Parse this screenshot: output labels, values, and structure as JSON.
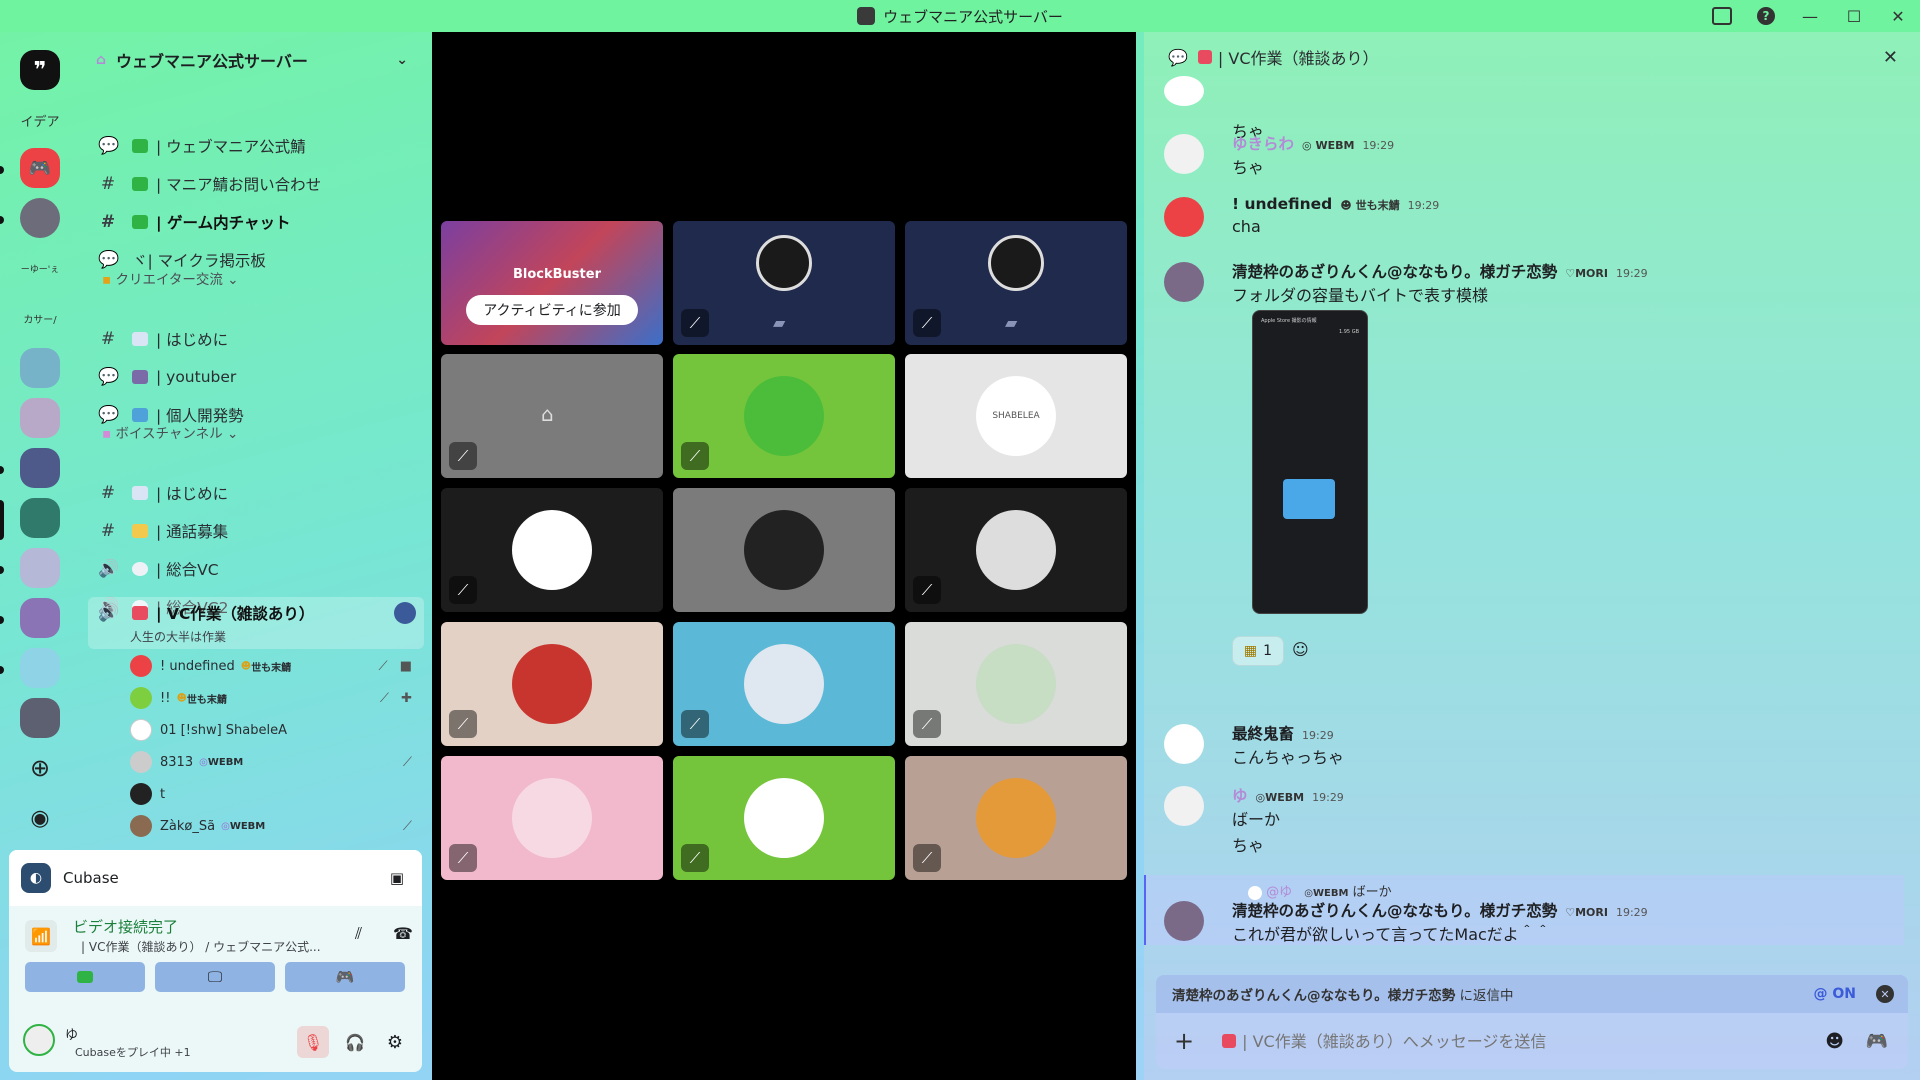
{
  "window": {
    "title": "ウェブマニア公式サーバー"
  },
  "rail": {
    "items": [
      {
        "label": "",
        "color": "#111111"
      },
      {
        "label": "イデア",
        "color": "transparent"
      },
      {
        "label": "",
        "color": "#ed4245"
      },
      {
        "label": "",
        "color": "#6c6c7a"
      },
      {
        "label": "ーゆー'ぇ",
        "color": "transparent"
      },
      {
        "label": "カサー/",
        "color": "transparent"
      },
      {
        "label": "",
        "color": "#76b3c9"
      },
      {
        "label": "",
        "color": "#b9a9c9"
      },
      {
        "label": "",
        "color": "#4d5a8a"
      },
      {
        "label": "",
        "color": "#2f7a6a"
      },
      {
        "label": "",
        "color": "#b6b8d8"
      },
      {
        "label": "",
        "color": "#8a74b5"
      },
      {
        "label": "",
        "color": "#8fd3e6"
      },
      {
        "label": "",
        "color": "#5c6070"
      }
    ]
  },
  "server": {
    "name": "ウェブマニア公式サーバー"
  },
  "channels": {
    "top": [
      {
        "label": "| ウェブマニア公式鯖",
        "icon": "forum",
        "bold": false
      },
      {
        "label": "| マニア鯖お問い合わせ",
        "icon": "hash",
        "bold": false
      },
      {
        "label": "| ゲーム内チャット",
        "icon": "hash",
        "bold": true
      },
      {
        "label": "ヾ| マイクラ掲示板",
        "icon": "forum",
        "bold": false
      }
    ],
    "creator_category": "クリエイター交流",
    "creator": [
      {
        "label": "| はじめに",
        "icon": "hash"
      },
      {
        "label": "| youtuber",
        "icon": "forum"
      },
      {
        "label": "| 個人開発勢",
        "icon": "forum"
      }
    ],
    "voice_category": "ボイスチャンネル",
    "voice": [
      {
        "label": "| はじめに",
        "icon": "hash"
      },
      {
        "label": "| 通話募集",
        "icon": "hash"
      },
      {
        "label": "| 総合VC",
        "icon": "speaker"
      },
      {
        "label": "| 総合VC2",
        "icon": "speaker"
      }
    ],
    "active_vc": {
      "label": "| VC作業（雑談あり）",
      "status": "人生の大半は作業"
    },
    "members": [
      {
        "name": "! undefined",
        "tag": "世も末鯖",
        "right": "⟋ ■",
        "color": "#ed4245"
      },
      {
        "name": "!!",
        "tag": "世も末鯖",
        "right": "⟋ ✚",
        "color": "#7ecf40"
      },
      {
        "name": "01 [!shw] ShabeleA",
        "tag": "",
        "right": "",
        "color": "#ffffff"
      },
      {
        "name": "8313",
        "tag": "WEBM",
        "right": "⟋",
        "color": "#cccccc"
      },
      {
        "name": "t",
        "tag": "",
        "right": "",
        "color": "#222222"
      },
      {
        "name": "Zàkø_Sã",
        "tag": "WEBM",
        "right": "⟋",
        "color": "#8a6a50"
      }
    ]
  },
  "activity": {
    "app": "Cubase"
  },
  "voice_status": {
    "title": "ビデオ接続完了",
    "sub": "| VC作業（雑談あり） / ウェブマニア公式..."
  },
  "user": {
    "name": "ゆ",
    "status": "Cubaseをプレイ中 +1"
  },
  "stage": {
    "activity_title": "BlockBuster",
    "activity_button": "アクティビティに参加",
    "tile_labels": [
      "SHABELEA"
    ]
  },
  "chat": {
    "channel": "| VC作業（雑談あり）",
    "messages": [
      {
        "author": "",
        "time": "",
        "body": "ちゃ",
        "tag": ""
      },
      {
        "author": "ゆきらわ",
        "time": "19:29",
        "body": "ちゃ",
        "tag": "WEBM"
      },
      {
        "author": "! undefined",
        "time": "19:29",
        "body": "cha",
        "tag": "世も末鯖"
      },
      {
        "author": "清楚枠のあざりんくん@ななもり。様ガチ恋勢",
        "time": "19:29",
        "body": "フォルダの容量もバイトで表す模様",
        "tag": "MORI"
      },
      {
        "author": "最終鬼畜",
        "time": "19:29",
        "body": "こんちゃっちゃ",
        "tag": ""
      },
      {
        "author": "ゆ",
        "time": "19:29",
        "body": "ばーか",
        "body2": "ちゃ",
        "tag": "WEBM"
      },
      {
        "author": "清楚枠のあざりんくん@ななもり。様ガチ恋勢",
        "time": "19:29",
        "body": "これが君が欲しいって言ってたMacだよ＾＾",
        "tag": "MORI"
      }
    ],
    "reaction_count": "1",
    "reply_preview": {
      "author": "@ゆ",
      "tag": "WEBM",
      "text": "ばーか"
    },
    "replying_to": "清楚枠のあざりんくん@ななもり。様ガチ恋勢",
    "replying_suffix": " に返信中",
    "mention_toggle": "@ ON",
    "composer_placeholder": "| VC作業（雑談あり）へメッセージを送信"
  },
  "screenshot_window": {
    "title": "Apple Store 撮影の情報",
    "size": "1.95 GB"
  }
}
